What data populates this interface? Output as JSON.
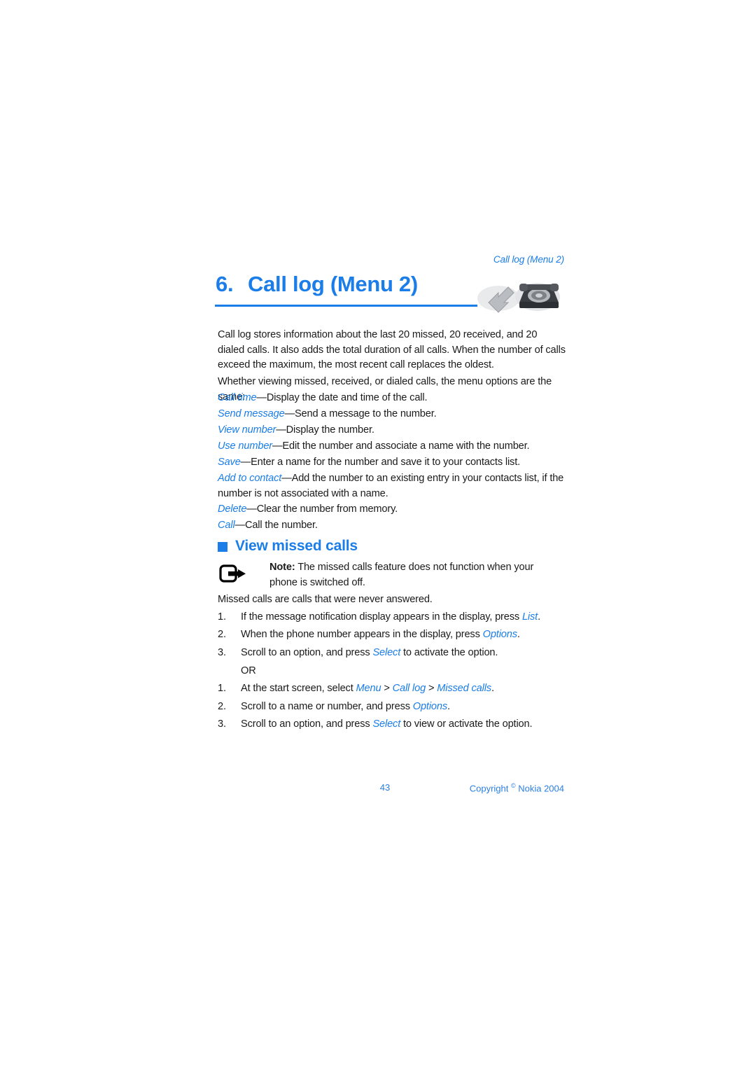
{
  "running_head": "Call log (Menu 2)",
  "chapter": {
    "number": "6.",
    "title": "Call log (Menu 2)",
    "icon_name": "telephone-arrow-icon",
    "rule_color": "#1a7de8",
    "accent_color": "#1a7de8"
  },
  "intro": {
    "paragraph_1": "Call log stores information about the last 20 missed, 20 received, and 20 dialed calls. It also adds the total duration of all calls. When the number of calls exceed the maximum, the most recent call replaces the oldest.",
    "paragraph_2": "Whether viewing missed, received, or dialed calls, the menu options are the same:"
  },
  "options": [
    {
      "term": "Call time",
      "dash": "—",
      "definition": "Display the date and time of the call."
    },
    {
      "term": "Send message",
      "dash": "—",
      "definition": "Send a message to the number."
    },
    {
      "term": "View number",
      "dash": "—",
      "definition": "Display the number."
    },
    {
      "term": "Use number",
      "dash": "—",
      "definition": "Edit the number and associate a name with the number."
    },
    {
      "term": "Save",
      "dash": "—",
      "definition": "Enter a name for the number and save it to your contacts list."
    },
    {
      "term": "Add to contact",
      "dash": "—",
      "definition": "Add the number to an existing entry in your contacts list, if the number is not associated with a name."
    },
    {
      "term": "Delete",
      "dash": "—",
      "definition": "Clear the number from memory."
    },
    {
      "term": "Call",
      "dash": "—",
      "definition": "Call the number."
    }
  ],
  "section": {
    "bullet_color": "#1a7de8",
    "label": "View missed calls"
  },
  "note": {
    "icon_name": "note-arrow-icon",
    "label": "Note:",
    "text": " The missed calls feature does not function when your phone is switched off."
  },
  "lead_in": "Missed calls are calls that were never answered.",
  "procedure_1": [
    {
      "marker": "1.",
      "pre": "If the message notification display appears in the display, press ",
      "ui": "List",
      "post": "."
    },
    {
      "marker": "2.",
      "pre": "When the phone number appears in the display, press ",
      "ui": "Options",
      "post": "."
    },
    {
      "marker": "3.",
      "pre": "Scroll to an option, and press ",
      "ui": "Select",
      "post": " to activate the option."
    }
  ],
  "or_divider": "OR",
  "procedure_2": [
    {
      "marker": "1.",
      "pre": "At the start screen, select ",
      "ui": "Menu",
      "sep1": " > ",
      "ui2": "Call log",
      "sep2": " > ",
      "ui3": "Missed calls",
      "post": "."
    },
    {
      "marker": "2.",
      "pre": "Scroll to a name or number, and press ",
      "ui": "Options",
      "post": "."
    },
    {
      "marker": "3.",
      "pre": "Scroll to an option, and press ",
      "ui": "Select",
      "post": " to view or activate the option."
    }
  ],
  "footer": {
    "page_number": "43",
    "copyright_prefix": "Copyright ",
    "copyright_symbol": "©",
    "copyright_suffix": " Nokia 2004"
  }
}
